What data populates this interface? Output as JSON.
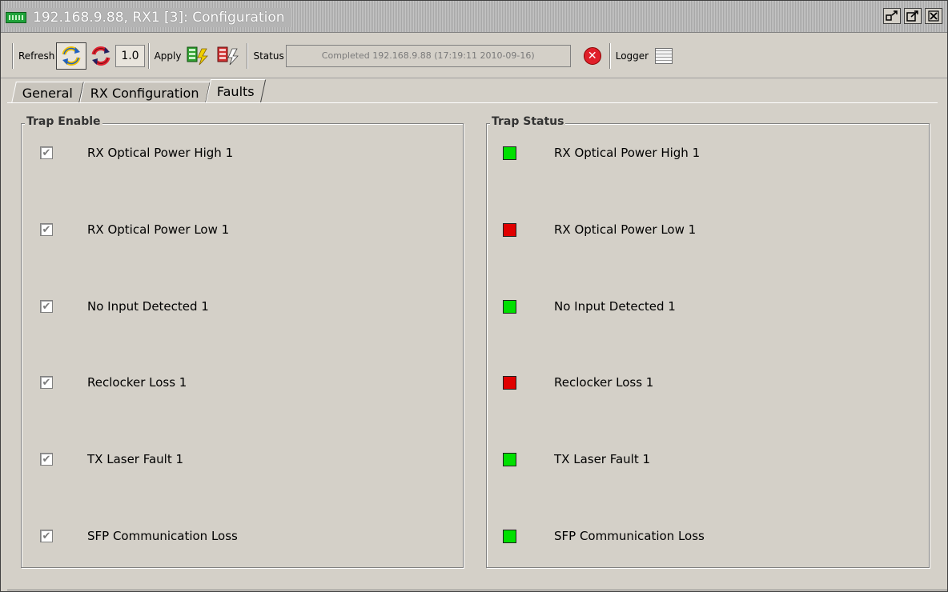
{
  "window": {
    "title": "192.168.9.88, RX1  [3]: Configuration",
    "controls": [
      "restore-icon",
      "maximize-icon",
      "close-icon"
    ]
  },
  "toolbar": {
    "refresh_label": "Refresh",
    "refresh_value": "1.0",
    "apply_label": "Apply",
    "status_label": "Status",
    "status_text": "Completed 192.168.9.88 (17:19:11  2010-09-16)",
    "logger_label": "Logger"
  },
  "tabs": [
    {
      "label": "General",
      "active": false
    },
    {
      "label": "RX Configuration",
      "active": false
    },
    {
      "label": "Faults",
      "active": true
    }
  ],
  "trap_enable": {
    "title": "Trap Enable",
    "items": [
      {
        "label": "RX Optical Power High 1",
        "checked": true
      },
      {
        "label": "RX Optical Power Low 1",
        "checked": true
      },
      {
        "label": "No Input Detected 1",
        "checked": true
      },
      {
        "label": "Reclocker Loss 1",
        "checked": true
      },
      {
        "label": "TX Laser Fault 1",
        "checked": true
      },
      {
        "label": "SFP Communication Loss",
        "checked": true
      }
    ]
  },
  "trap_status": {
    "title": "Trap Status",
    "items": [
      {
        "label": "RX Optical Power High 1",
        "color": "#00e000"
      },
      {
        "label": "RX Optical Power Low 1",
        "color": "#e00000"
      },
      {
        "label": "No Input Detected 1",
        "color": "#00e000"
      },
      {
        "label": "Reclocker Loss 1",
        "color": "#e00000"
      },
      {
        "label": "TX Laser Fault 1",
        "color": "#00e000"
      },
      {
        "label": "SFP Communication Loss",
        "color": "#00e000"
      }
    ]
  }
}
